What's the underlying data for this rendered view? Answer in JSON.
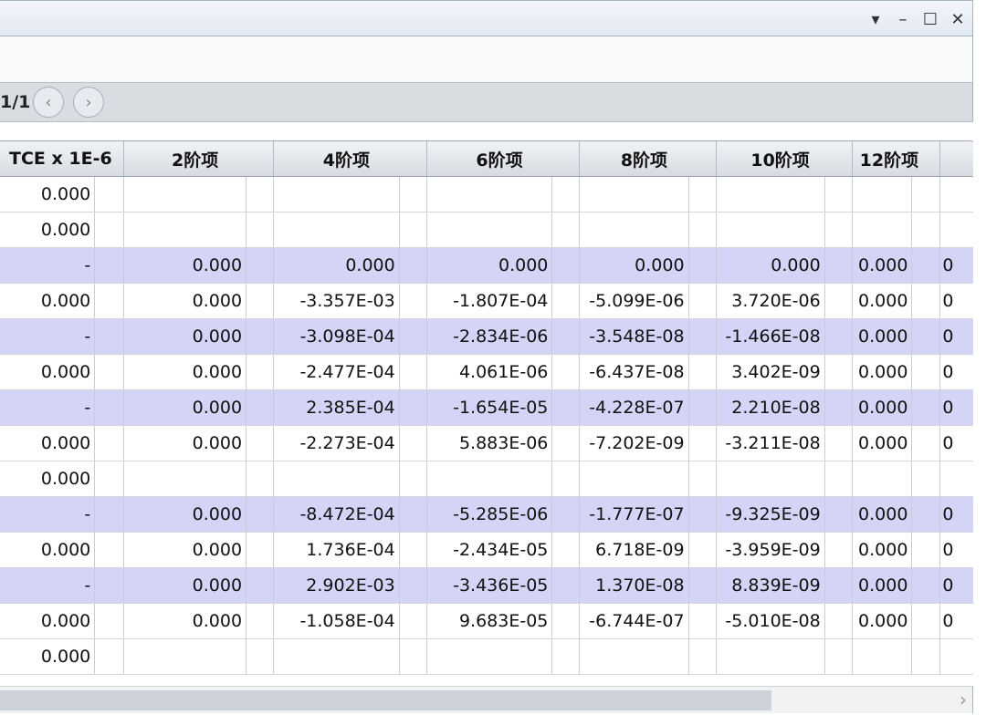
{
  "window": {
    "controls": {
      "menu": "▾",
      "minimize": "–",
      "maximize": "☐",
      "close": "✕"
    }
  },
  "pager": {
    "text": "1/1",
    "prev_icon": "‹",
    "next_icon": "›"
  },
  "grid": {
    "columns": [
      "TCE x 1E-6",
      "2阶项",
      "4阶项",
      "6阶项",
      "8阶项",
      "10阶项",
      "12阶项"
    ],
    "rows": [
      {
        "style": "norm",
        "cells": [
          "0.000",
          "",
          "",
          "",
          "",
          "",
          "",
          ""
        ]
      },
      {
        "style": "norm",
        "cells": [
          "0.000",
          "",
          "",
          "",
          "",
          "",
          "",
          ""
        ]
      },
      {
        "style": "alt",
        "cells": [
          "-",
          "0.000",
          "0.000",
          "0.000",
          "0.000",
          "0.000",
          "0.000",
          "0"
        ]
      },
      {
        "style": "norm",
        "cells": [
          "0.000",
          "0.000",
          "-3.357E-03",
          "-1.807E-04",
          "-5.099E-06",
          "3.720E-06",
          "0.000",
          "0"
        ]
      },
      {
        "style": "alt",
        "cells": [
          "-",
          "0.000",
          "-3.098E-04",
          "-2.834E-06",
          "-3.548E-08",
          "-1.466E-08",
          "0.000",
          "0"
        ]
      },
      {
        "style": "norm",
        "cells": [
          "0.000",
          "0.000",
          "-2.477E-04",
          "4.061E-06",
          "-6.437E-08",
          "3.402E-09",
          "0.000",
          "0"
        ]
      },
      {
        "style": "alt",
        "cells": [
          "-",
          "0.000",
          "2.385E-04",
          "-1.654E-05",
          "-4.228E-07",
          "2.210E-08",
          "0.000",
          "0"
        ]
      },
      {
        "style": "norm",
        "cells": [
          "0.000",
          "0.000",
          "-2.273E-04",
          "5.883E-06",
          "-7.202E-09",
          "-3.211E-08",
          "0.000",
          "0"
        ]
      },
      {
        "style": "norm",
        "cells": [
          "0.000",
          "",
          "",
          "",
          "",
          "",
          "",
          ""
        ]
      },
      {
        "style": "alt",
        "cells": [
          "-",
          "0.000",
          "-8.472E-04",
          "-5.285E-06",
          "-1.777E-07",
          "-9.325E-09",
          "0.000",
          "0"
        ]
      },
      {
        "style": "norm",
        "cells": [
          "0.000",
          "0.000",
          "1.736E-04",
          "-2.434E-05",
          "6.718E-09",
          "-3.959E-09",
          "0.000",
          "0"
        ]
      },
      {
        "style": "alt",
        "cells": [
          "-",
          "0.000",
          "2.902E-03",
          "-3.436E-05",
          "1.370E-08",
          "8.839E-09",
          "0.000",
          "0"
        ]
      },
      {
        "style": "norm",
        "cells": [
          "0.000",
          "0.000",
          "-1.058E-04",
          "9.683E-05",
          "-6.744E-07",
          "-5.010E-08",
          "0.000",
          "0"
        ]
      },
      {
        "style": "norm",
        "cells": [
          "0.000",
          "",
          "",
          "",
          "",
          "",
          "",
          ""
        ]
      }
    ]
  },
  "scrollbar": {
    "right_icon": "›"
  }
}
